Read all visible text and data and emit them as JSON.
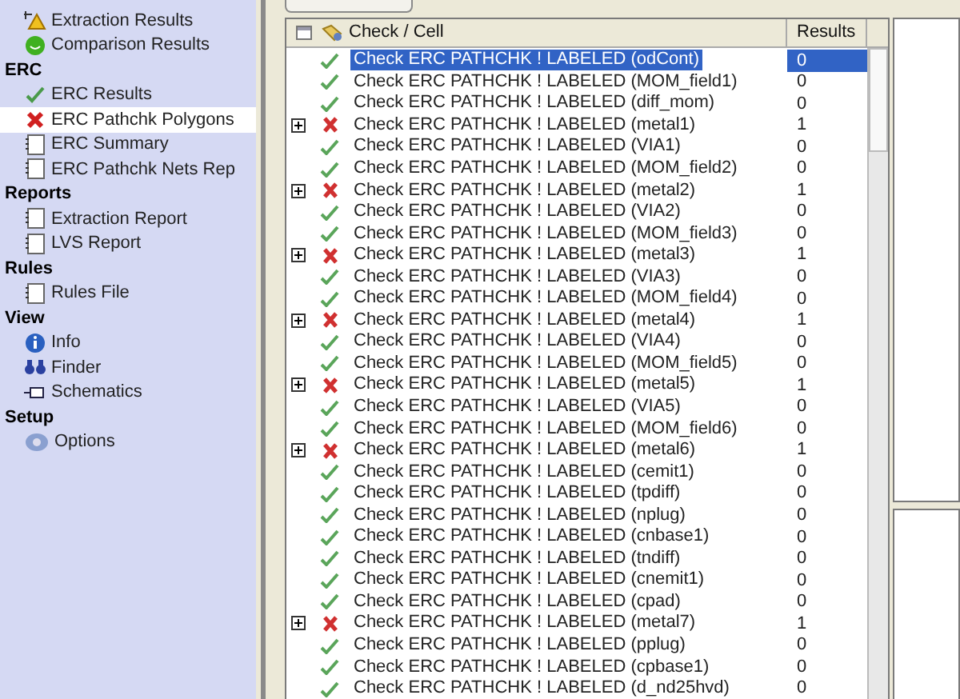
{
  "sidebar": [
    {
      "kind": "item",
      "label": "Extraction Results",
      "selected": false
    },
    {
      "kind": "item",
      "label": "Comparison Results",
      "selected": false
    },
    {
      "kind": "heading",
      "label": "ERC"
    },
    {
      "kind": "item",
      "label": "ERC Results",
      "selected": false
    },
    {
      "kind": "item",
      "label": "ERC Pathchk Polygons",
      "selected": true
    },
    {
      "kind": "item",
      "label": "ERC Summary",
      "selected": false
    },
    {
      "kind": "item",
      "label": "ERC Pathchk Nets Rep",
      "selected": false
    },
    {
      "kind": "heading",
      "label": "Reports"
    },
    {
      "kind": "item",
      "label": "Extraction Report",
      "selected": false
    },
    {
      "kind": "item",
      "label": "LVS Report",
      "selected": false
    },
    {
      "kind": "heading",
      "label": "Rules"
    },
    {
      "kind": "item",
      "label": "Rules File",
      "selected": false
    },
    {
      "kind": "heading",
      "label": "View"
    },
    {
      "kind": "item",
      "label": "Info",
      "selected": false
    },
    {
      "kind": "item",
      "label": "Finder",
      "selected": false
    },
    {
      "kind": "item",
      "label": "Schematics",
      "selected": false
    },
    {
      "kind": "heading",
      "label": "Setup"
    },
    {
      "kind": "item",
      "label": "Options",
      "selected": false
    }
  ],
  "table": {
    "columns": [
      "Check / Cell",
      "Results"
    ],
    "rows": [
      {
        "check": "Check ERC PATHCHK ! LABELED (odCont)",
        "results": "0",
        "passed": true,
        "expandable": false,
        "selected": true
      },
      {
        "check": "Check ERC PATHCHK ! LABELED (MOM_field1)",
        "results": "0",
        "passed": true,
        "expandable": false,
        "selected": false
      },
      {
        "check": "Check ERC PATHCHK ! LABELED (diff_mom)",
        "results": "0",
        "passed": true,
        "expandable": false,
        "selected": false
      },
      {
        "check": "Check ERC PATHCHK ! LABELED (metal1)",
        "results": "1",
        "passed": false,
        "expandable": true,
        "selected": false
      },
      {
        "check": "Check ERC PATHCHK ! LABELED (VIA1)",
        "results": "0",
        "passed": true,
        "expandable": false,
        "selected": false
      },
      {
        "check": "Check ERC PATHCHK ! LABELED (MOM_field2)",
        "results": "0",
        "passed": true,
        "expandable": false,
        "selected": false
      },
      {
        "check": "Check ERC PATHCHK ! LABELED (metal2)",
        "results": "1",
        "passed": false,
        "expandable": true,
        "selected": false
      },
      {
        "check": "Check ERC PATHCHK ! LABELED (VIA2)",
        "results": "0",
        "passed": true,
        "expandable": false,
        "selected": false
      },
      {
        "check": "Check ERC PATHCHK ! LABELED (MOM_field3)",
        "results": "0",
        "passed": true,
        "expandable": false,
        "selected": false
      },
      {
        "check": "Check ERC PATHCHK ! LABELED (metal3)",
        "results": "1",
        "passed": false,
        "expandable": true,
        "selected": false
      },
      {
        "check": "Check ERC PATHCHK ! LABELED (VIA3)",
        "results": "0",
        "passed": true,
        "expandable": false,
        "selected": false
      },
      {
        "check": "Check ERC PATHCHK ! LABELED (MOM_field4)",
        "results": "0",
        "passed": true,
        "expandable": false,
        "selected": false
      },
      {
        "check": "Check ERC PATHCHK ! LABELED (metal4)",
        "results": "1",
        "passed": false,
        "expandable": true,
        "selected": false
      },
      {
        "check": "Check ERC PATHCHK ! LABELED (VIA4)",
        "results": "0",
        "passed": true,
        "expandable": false,
        "selected": false
      },
      {
        "check": "Check ERC PATHCHK ! LABELED (MOM_field5)",
        "results": "0",
        "passed": true,
        "expandable": false,
        "selected": false
      },
      {
        "check": "Check ERC PATHCHK ! LABELED (metal5)",
        "results": "1",
        "passed": false,
        "expandable": true,
        "selected": false
      },
      {
        "check": "Check ERC PATHCHK ! LABELED (VIA5)",
        "results": "0",
        "passed": true,
        "expandable": false,
        "selected": false
      },
      {
        "check": "Check ERC PATHCHK ! LABELED (MOM_field6)",
        "results": "0",
        "passed": true,
        "expandable": false,
        "selected": false
      },
      {
        "check": "Check ERC PATHCHK ! LABELED (metal6)",
        "results": "1",
        "passed": false,
        "expandable": true,
        "selected": false
      },
      {
        "check": "Check ERC PATHCHK ! LABELED (cemit1)",
        "results": "0",
        "passed": true,
        "expandable": false,
        "selected": false
      },
      {
        "check": "Check ERC PATHCHK ! LABELED (tpdiff)",
        "results": "0",
        "passed": true,
        "expandable": false,
        "selected": false
      },
      {
        "check": "Check ERC PATHCHK ! LABELED (nplug)",
        "results": "0",
        "passed": true,
        "expandable": false,
        "selected": false
      },
      {
        "check": "Check ERC PATHCHK ! LABELED (cnbase1)",
        "results": "0",
        "passed": true,
        "expandable": false,
        "selected": false
      },
      {
        "check": "Check ERC PATHCHK ! LABELED (tndiff)",
        "results": "0",
        "passed": true,
        "expandable": false,
        "selected": false
      },
      {
        "check": "Check ERC PATHCHK ! LABELED (cnemit1)",
        "results": "0",
        "passed": true,
        "expandable": false,
        "selected": false
      },
      {
        "check": "Check ERC PATHCHK ! LABELED (cpad)",
        "results": "0",
        "passed": true,
        "expandable": false,
        "selected": false
      },
      {
        "check": "Check ERC PATHCHK ! LABELED (metal7)",
        "results": "1",
        "passed": false,
        "expandable": true,
        "selected": false
      },
      {
        "check": "Check ERC PATHCHK ! LABELED (pplug)",
        "results": "0",
        "passed": true,
        "expandable": false,
        "selected": false
      },
      {
        "check": "Check ERC PATHCHK ! LABELED (cpbase1)",
        "results": "0",
        "passed": true,
        "expandable": false,
        "selected": false
      },
      {
        "check": "Check ERC PATHCHK ! LABELED (d_nd25hvd)",
        "results": "0",
        "passed": true,
        "expandable": false,
        "selected": false
      }
    ]
  }
}
